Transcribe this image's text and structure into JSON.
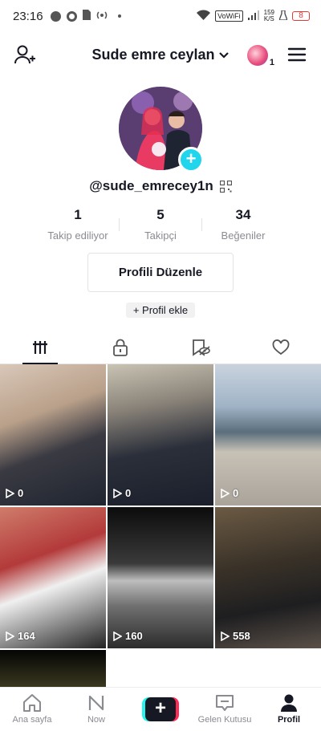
{
  "status_bar": {
    "time": "23:16",
    "network": "VoWiFi",
    "speed_top": "159",
    "speed_bottom": "K/S",
    "battery": "8"
  },
  "header": {
    "title": "Sude emre ceylan",
    "account_count": "1"
  },
  "profile": {
    "username": "@sude_emrecey1n",
    "stats": [
      {
        "value": "1",
        "label": "Takip ediliyor"
      },
      {
        "value": "5",
        "label": "Takipçi"
      },
      {
        "value": "34",
        "label": "Beğeniler"
      }
    ],
    "edit_button": "Profili Düzenle",
    "add_button": "+ Profil ekle"
  },
  "videos": [
    {
      "views": "0"
    },
    {
      "views": "0"
    },
    {
      "views": "0"
    },
    {
      "views": "164"
    },
    {
      "views": "160"
    },
    {
      "views": "558"
    }
  ],
  "nav": {
    "home": "Ana sayfa",
    "now": "Now",
    "inbox": "Gelen Kutusu",
    "profile": "Profil"
  },
  "colors": {
    "accent_cyan": "#20d5ec",
    "brand_red": "#fe2c55",
    "brand_cyan": "#25f4ee",
    "text_primary": "#161823",
    "text_secondary": "#8a8b91"
  }
}
